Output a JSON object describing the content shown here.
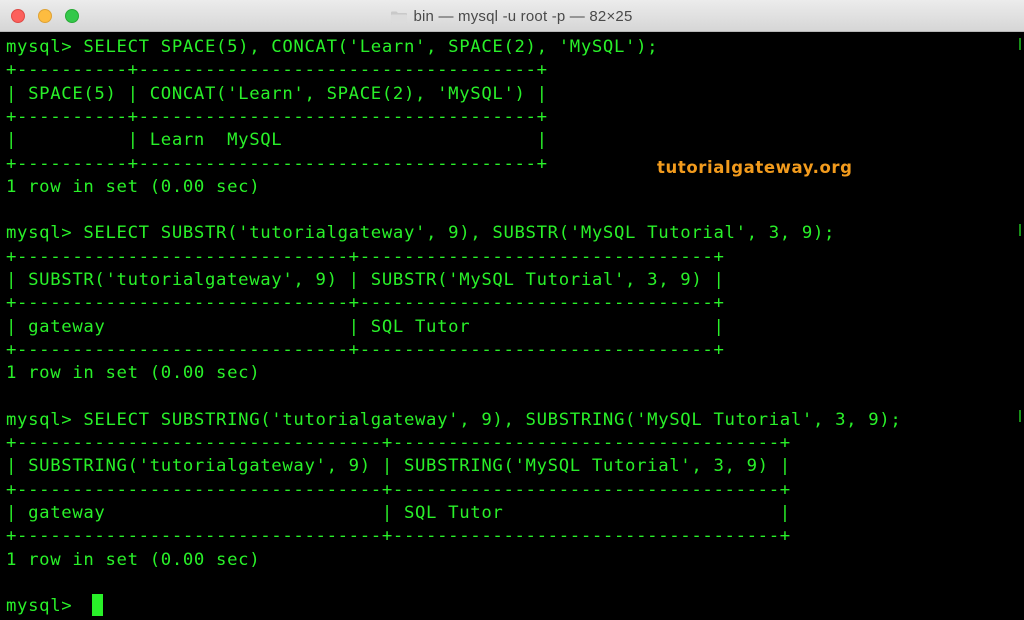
{
  "window": {
    "title": "bin — mysql -u root -p — 82×25"
  },
  "colors": {
    "terminal_text": "#29f029",
    "terminal_bg": "#000000",
    "watermark": "#f29b1d"
  },
  "watermark": "tutorialgateway.org",
  "terminal": {
    "lines": [
      "mysql> SELECT SPACE(5), CONCAT('Learn', SPACE(2), 'MySQL');",
      "+----------+------------------------------------+",
      "| SPACE(5) | CONCAT('Learn', SPACE(2), 'MySQL') |",
      "+----------+------------------------------------+",
      "|          | Learn  MySQL                       |",
      "+----------+------------------------------------+",
      "1 row in set (0.00 sec)",
      "",
      "mysql> SELECT SUBSTR('tutorialgateway', 9), SUBSTR('MySQL Tutorial', 3, 9);",
      "+------------------------------+--------------------------------+",
      "| SUBSTR('tutorialgateway', 9) | SUBSTR('MySQL Tutorial', 3, 9) |",
      "+------------------------------+--------------------------------+",
      "| gateway                      | SQL Tutor                      |",
      "+------------------------------+--------------------------------+",
      "1 row in set (0.00 sec)",
      "",
      "mysql> SELECT SUBSTRING('tutorialgateway', 9), SUBSTRING('MySQL Tutorial', 3, 9);",
      "+---------------------------------+-----------------------------------+",
      "| SUBSTRING('tutorialgateway', 9) | SUBSTRING('MySQL Tutorial', 3, 9) |",
      "+---------------------------------+-----------------------------------+",
      "| gateway                         | SQL Tutor                         |",
      "+---------------------------------+-----------------------------------+",
      "1 row in set (0.00 sec)",
      "",
      "mysql> "
    ]
  }
}
